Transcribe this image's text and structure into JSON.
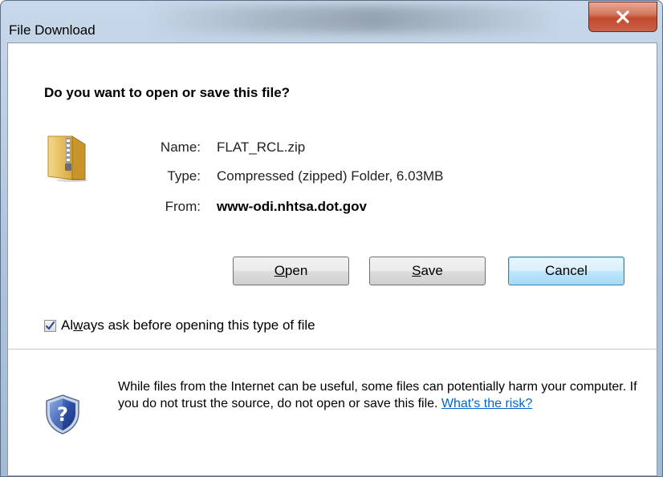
{
  "window": {
    "title": "File Download"
  },
  "dialog": {
    "question": "Do you want to open or save this file?",
    "file": {
      "name_label": "Name:",
      "name_value": "FLAT_RCL.zip",
      "type_label": "Type:",
      "type_value": "Compressed (zipped) Folder, 6.03MB",
      "from_label": "From:",
      "from_value": "www-odi.nhtsa.dot.gov"
    },
    "buttons": {
      "open_label_accel": "O",
      "open_label_rest": "pen",
      "save_label_accel": "S",
      "save_label_rest": "ave",
      "cancel_label": "Cancel"
    },
    "checkbox": {
      "label_pre": "Al",
      "label_accel": "w",
      "label_post": "ays ask before opening this type of file",
      "checked": true
    },
    "warning": {
      "text": "While files from the Internet can be useful, some files can potentially harm your computer. If you do not trust the source, do not open or save this file. ",
      "link": "What's the risk?"
    }
  },
  "icons": {
    "close": "close-icon",
    "folder": "zip-folder-icon",
    "shield": "security-shield-icon",
    "check": "checkmark-icon"
  },
  "colors": {
    "close_button": "#c24a2e",
    "link": "#0066cc",
    "default_button_border": "#3c7fb1",
    "shield_blue": "#2b4fa8"
  }
}
